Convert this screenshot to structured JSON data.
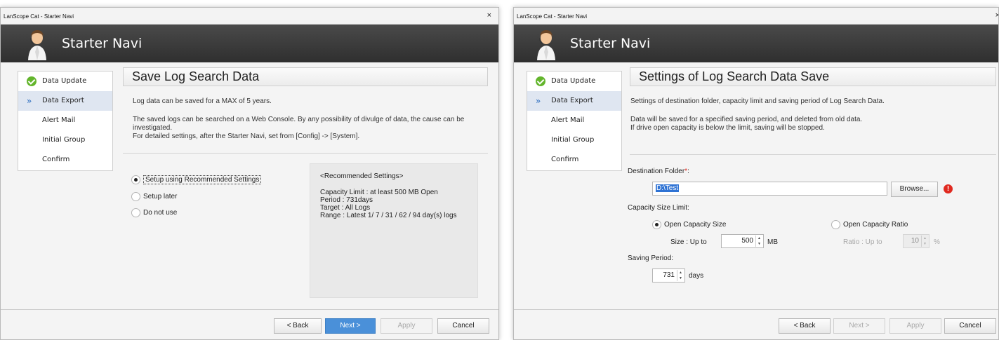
{
  "left_window": {
    "title": "LanScope Cat - Starter Navi",
    "close": "×",
    "brand": "Starter Navi",
    "nav": [
      {
        "label": "Data Update",
        "icon": "check-circle-icon",
        "active": false
      },
      {
        "label": "Data Export",
        "icon": "chevron-right-icon",
        "active": true
      },
      {
        "label": "Alert Mail",
        "icon": "",
        "active": false
      },
      {
        "label": "Initial Group",
        "icon": "",
        "active": false
      },
      {
        "label": "Confirm",
        "icon": "",
        "active": false
      }
    ],
    "page_title": "Save Log Search Data",
    "desc1": "Log data can be saved for a MAX of 5 years.",
    "desc2": "The saved logs can be searched on a Web Console. By any possibility of divulge of data, the cause can be investigated.",
    "desc3": "For detailed settings, after the Starter Navi, set from [Config] -> [System].",
    "options": [
      {
        "label": "Setup using Recommended Settings",
        "selected": true
      },
      {
        "label": "Setup later",
        "selected": false
      },
      {
        "label": "Do not use",
        "selected": false
      }
    ],
    "recommended": {
      "heading": "<Recommended Settings>",
      "capacity": "Capacity Limit : at least 500 MB Open",
      "period": "Period : 731days",
      "target": "Target : All Logs",
      "range": "Range : Latest 1/ 7 / 31 / 62 / 94 day(s) logs"
    },
    "buttons": {
      "back": "< Back",
      "next": "Next >",
      "apply": "Apply",
      "cancel": "Cancel"
    }
  },
  "right_window": {
    "title": "LanScope Cat - Starter Navi",
    "close": "×",
    "brand": "Starter Navi",
    "nav": [
      {
        "label": "Data Update",
        "icon": "check-circle-icon",
        "active": false
      },
      {
        "label": "Data Export",
        "icon": "chevron-right-icon",
        "active": true
      },
      {
        "label": "Alert Mail",
        "icon": "",
        "active": false
      },
      {
        "label": "Initial Group",
        "icon": "",
        "active": false
      },
      {
        "label": "Confirm",
        "icon": "",
        "active": false
      }
    ],
    "page_title": "Settings of Log Search Data Save",
    "desc1": "Settings of destination folder, capacity limit and saving period of Log Search Data.",
    "desc2": "Data will be saved for a specified saving period, and deleted from old data.",
    "desc3": "If drive open capacity is below the limit, saving will be stopped.",
    "destination_label": "Destination Folder",
    "required_mark": "*",
    "label_colon": ":",
    "destination_value": "D:\\Test",
    "browse": "Browse...",
    "capacity_label": "Capacity Size Limit:",
    "open_capacity_size": "Open Capacity Size",
    "open_capacity_ratio": "Open Capacity Ratio",
    "size_label": "Size : Up to",
    "size_value": "500",
    "size_unit": "MB",
    "ratio_label": "Ratio : Up to",
    "ratio_value": "10",
    "ratio_unit": "%",
    "saving_label": "Saving Period:",
    "saving_value": "731",
    "saving_unit": "days",
    "buttons": {
      "back": "< Back",
      "next": "Next >",
      "apply": "Apply",
      "cancel": "Cancel"
    }
  },
  "colors": {
    "accent": "#4a90d9",
    "banner": "#3a3a3a",
    "success": "#63b52c",
    "error": "#e0291f",
    "nav_active": "#dfe6f1"
  }
}
